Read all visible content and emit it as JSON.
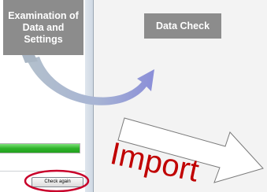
{
  "diagram": {
    "box_examination": "Examination of Data and Settings",
    "box_data_check": "Data Check",
    "import_label": "Import"
  },
  "screenshot": {
    "button_label": "Check again",
    "progress_fraction": 1.0
  },
  "colors": {
    "box_fill": "#8c8c8c",
    "arc_blue": "#8a8ed8",
    "arc_grey_blue": "#a9b6c4",
    "import_red": "#c00000",
    "highlight_red": "#c8002a",
    "progress_green": "#2fb32b"
  }
}
